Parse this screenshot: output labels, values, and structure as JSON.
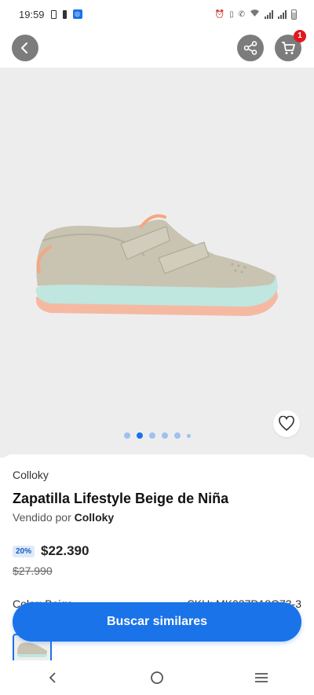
{
  "status_bar": {
    "time": "19:59",
    "icons": [
      "battery-saver-icon",
      "sim-icon",
      "app-notification-icon",
      "alarm-icon",
      "vibrate-icon",
      "wifi-calling-icon",
      "wifi-icon",
      "signal-icon",
      "signal-icon-2",
      "battery-icon"
    ]
  },
  "header": {
    "back_icon": "chevron-left-icon",
    "share_icon": "share-icon",
    "cart_icon": "cart-icon",
    "cart_count": "1"
  },
  "gallery": {
    "favorite_icon": "heart-icon",
    "dots_count": 6,
    "active_dot": 1
  },
  "product": {
    "brand": "Colloky",
    "title": "Zapatilla Lifestyle Beige de Niña",
    "seller_prefix": "Vendido por",
    "seller_name": "Colloky",
    "discount": "20%",
    "price": "$22.390",
    "old_price": "$27.990",
    "color_label": "Color: Beige",
    "sku": "SKU: MK037D18O73-3"
  },
  "cta": {
    "label": "Buscar similares"
  },
  "navbar": {
    "icons": [
      "back-nav-icon",
      "home-nav-icon",
      "recents-nav-icon"
    ]
  },
  "colors": {
    "accent": "#1a73e8",
    "badge": "#e1191f",
    "image_bg": "#eeedee"
  }
}
